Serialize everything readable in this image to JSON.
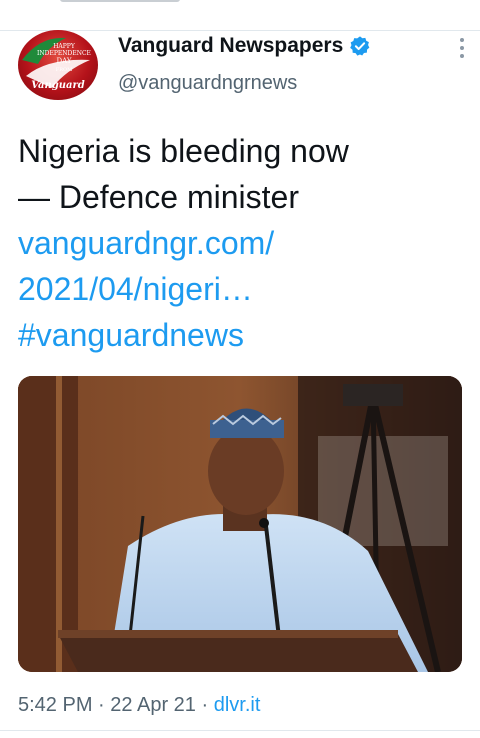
{
  "tweet": {
    "author": {
      "display_name": "Vanguard Newspapers",
      "handle": "@vanguardngrnews",
      "verified": true,
      "avatar_text": {
        "line1": "HAPPY",
        "line2": "INDEPENDENCE",
        "line3": "DAY",
        "line4": "FROM",
        "brand": "Vanguard"
      }
    },
    "text_lines": [
      "Nigeria is bleeding now",
      "— Defence minister"
    ],
    "link_lines": [
      "vanguardngr.com/",
      "2021/04/nigeri…"
    ],
    "hashtag": "#vanguardnews",
    "media": {
      "type": "photo"
    },
    "time": "5:42 PM",
    "date": "22 Apr 21",
    "separator": "·",
    "source": "dlvr.it"
  },
  "colors": {
    "link": "#1d9bf0",
    "secondary_text": "#536471",
    "primary_text": "#0f1419",
    "verified_badge": "#1d9bf0"
  },
  "icons": {
    "verified": "verified-badge-icon",
    "more": "more-vertical-icon"
  }
}
